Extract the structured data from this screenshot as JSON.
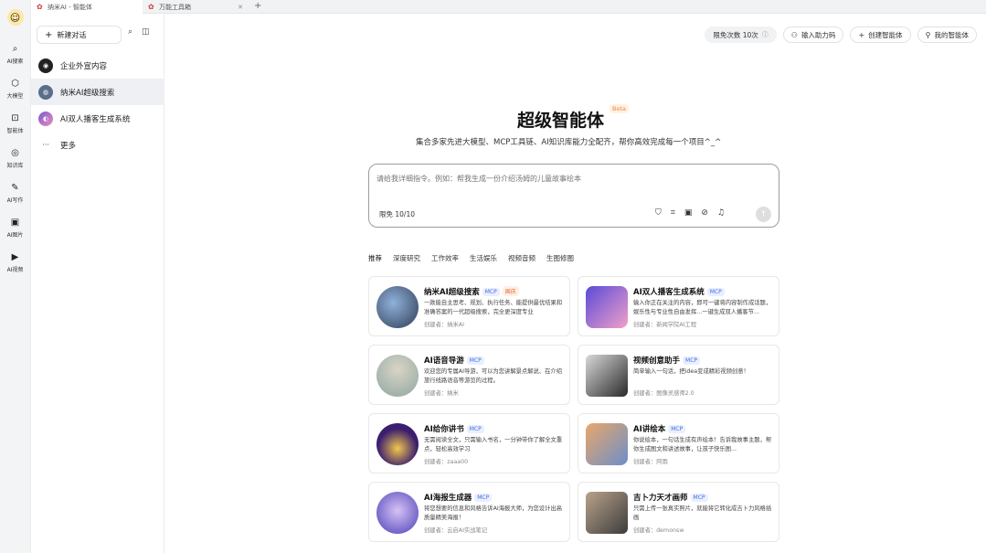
{
  "tabs": [
    {
      "label": "纳米AI - 智能体",
      "active": true
    },
    {
      "label": "万能工具箱",
      "active": false
    }
  ],
  "rail": {
    "items": [
      {
        "icon": "search-icon",
        "glyph": "⌕",
        "label": "AI搜索"
      },
      {
        "icon": "cube-icon",
        "glyph": "⬡",
        "label": "大模型"
      },
      {
        "icon": "agent-icon",
        "glyph": "⊡",
        "label": "智能体"
      },
      {
        "icon": "knowledge-icon",
        "glyph": "◎",
        "label": "知识库"
      },
      {
        "icon": "pen-icon",
        "glyph": "✎",
        "label": "AI写作"
      },
      {
        "icon": "image-icon",
        "glyph": "▣",
        "label": "AI图片"
      },
      {
        "icon": "video-icon",
        "glyph": "▶",
        "label": "AI视频"
      }
    ]
  },
  "sidebar": {
    "new_chat": "新建对话",
    "items": [
      {
        "label": "企业外宣内容",
        "color": "#222222",
        "glyph": "◉"
      },
      {
        "label": "纳米AI超级搜索",
        "color": "#5a6e8c",
        "glyph": "◍"
      },
      {
        "label": "AI双人播客生成系统",
        "color": "#7b5ad6",
        "glyph": "◐"
      },
      {
        "label": "更多",
        "color": "#ffffff",
        "glyph": "···"
      }
    ]
  },
  "header": {
    "quota": "限免次数 10次",
    "enter_code": "输入助力码",
    "create_agent": "创建智能体",
    "my_agents": "我的智能体"
  },
  "hero": {
    "title": "超级智能体",
    "beta": "Beta",
    "subtitle": "集合多家先进大模型、MCP工具链、AI知识库能力全配齐，帮你高效完成每一个项目^_^"
  },
  "composer": {
    "placeholder": "请给我详细指令。例如：帮我生成一份介绍汤姆的儿童故事绘本",
    "quota": "限免 10/10"
  },
  "categories": [
    "推荐",
    "深度研究",
    "工作效率",
    "生活娱乐",
    "视频音频",
    "生图修图"
  ],
  "cards": [
    {
      "title": "纳米AI超级搜索",
      "badges": [
        "MCP",
        "国庆"
      ],
      "desc": "一款能自主思考、规划、执行任务、能提供最优结果和准确答案的一代超级搜索，完全更深度专业",
      "author": "创建者：纳米AI",
      "thumb": [
        "#2f3b55",
        "#8fb1d9"
      ]
    },
    {
      "title": "AI双人播客生成系统",
      "badges": [
        "MCP"
      ],
      "desc": "输入你正在关注的内容，即可一键将内容制作成话题，娱乐性与专业性自由发挥...一键生成双人播客节...",
      "author": "创建者：新闻学院AI工程",
      "thumb": [
        "#5b4ad8",
        "#f0a0c8"
      ]
    },
    {
      "title": "AI语音导游",
      "badges": [
        "MCP"
      ],
      "desc": "欢迎您的专属AI导游，可以为您讲解景点解说、在介绍旅行线路语音等游览的过程。",
      "author": "创建者：纳米",
      "thumb": [
        "#8fa7a0",
        "#d9d4c6"
      ]
    },
    {
      "title": "视频创意助手",
      "badges": [
        "MCP"
      ],
      "desc": "简单输入一句话，把idea变成精彩视频创意！",
      "author": "创建者：图像灵感师2.0",
      "thumb": [
        "#2a2a2a",
        "#d9d9d9"
      ]
    },
    {
      "title": "AI给你讲书",
      "badges": [
        "MCP"
      ],
      "desc": "无需阅读全文，只需输入书名，一分钟带你了解全文重点，轻松高效学习",
      "author": "创建者：zaaa00",
      "thumb": [
        "#3b1e6e",
        "#f2c84b"
      ]
    },
    {
      "title": "AI讲绘本",
      "badges": [
        "MCP"
      ],
      "desc": "你说绘本，一句话生成有声绘本！告诉我故事主题，帮你生成图文和讲述故事，让孩子快乐图...",
      "author": "创建者：阿雨",
      "thumb": [
        "#e9a76a",
        "#6b8fc9"
      ]
    },
    {
      "title": "AI海报生成器",
      "badges": [
        "MCP"
      ],
      "desc": "将您想要的信息和风格告诉AI海报大师，为您设计出高质量精美海报！",
      "author": "创建者：云启AI实战笔记",
      "thumb": [
        "#4a3fb8",
        "#d7c2f4"
      ]
    },
    {
      "title": "吉卜力天才画师",
      "badges": [
        "MCP"
      ],
      "desc": "只需上传一张真实照片，就能将它转化成吉卜力风格插画",
      "author": "创建者：demonsw",
      "thumb": [
        "#3c3c3c",
        "#b9a38a"
      ]
    }
  ]
}
